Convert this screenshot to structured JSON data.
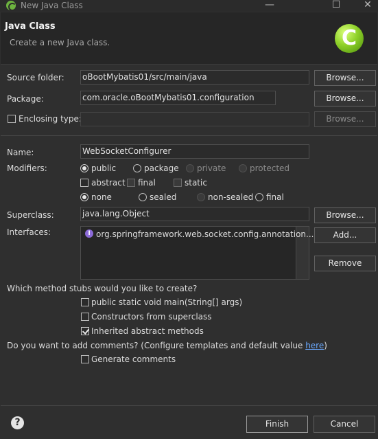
{
  "window": {
    "title": "New Java Class",
    "minimize_glyph": "—",
    "maximize_glyph": "☐",
    "close_glyph": "✕"
  },
  "header": {
    "title": "Java Class",
    "subtitle": "Create a new Java class.",
    "logo_letter": "C"
  },
  "source_folder": {
    "label": "Source folder:",
    "value": "oBootMybatis01/src/main/java",
    "browse": "Browse..."
  },
  "package": {
    "label": "Package:",
    "value": "com.oracle.oBootMybatis01.configuration",
    "browse": "Browse..."
  },
  "enclosing_type": {
    "label": "Enclosing type:",
    "value": "",
    "browse": "Browse...",
    "checked": false
  },
  "name": {
    "label": "Name:",
    "value": "WebSocketConfigurer"
  },
  "modifiers": {
    "label": "Modifiers:",
    "access": [
      "public",
      "package",
      "private",
      "protected"
    ],
    "access_selected": "public",
    "flags": [
      "abstract",
      "final",
      "static"
    ],
    "sealing": [
      "none",
      "sealed",
      "non-sealed",
      "final"
    ],
    "sealing_selected": "none"
  },
  "superclass": {
    "label": "Superclass:",
    "value": "java.lang.Object",
    "browse": "Browse..."
  },
  "interfaces": {
    "label": "Interfaces:",
    "items": [
      "org.springframework.web.socket.config.annotation...."
    ],
    "item_icon": "I",
    "add": "Add...",
    "remove": "Remove"
  },
  "stubs": {
    "question": "Which method stubs would you like to create?",
    "options": [
      {
        "label": "public static void main(String[] args)",
        "checked": false
      },
      {
        "label": "Constructors from superclass",
        "checked": false
      },
      {
        "label": "Inherited abstract methods",
        "checked": true
      }
    ]
  },
  "comments": {
    "question_prefix": "Do you want to add comments? (Configure templates and default value ",
    "link": "here",
    "question_suffix": ")",
    "option": "Generate comments",
    "checked": false
  },
  "footer": {
    "help_glyph": "?",
    "finish": "Finish",
    "cancel": "Cancel"
  },
  "colors": {
    "background": "#2f2f2f",
    "banner": "#262626",
    "link": "#6aa9ff",
    "logo_green": "#8fd12a",
    "interface_icon": "#8c6bd8"
  }
}
